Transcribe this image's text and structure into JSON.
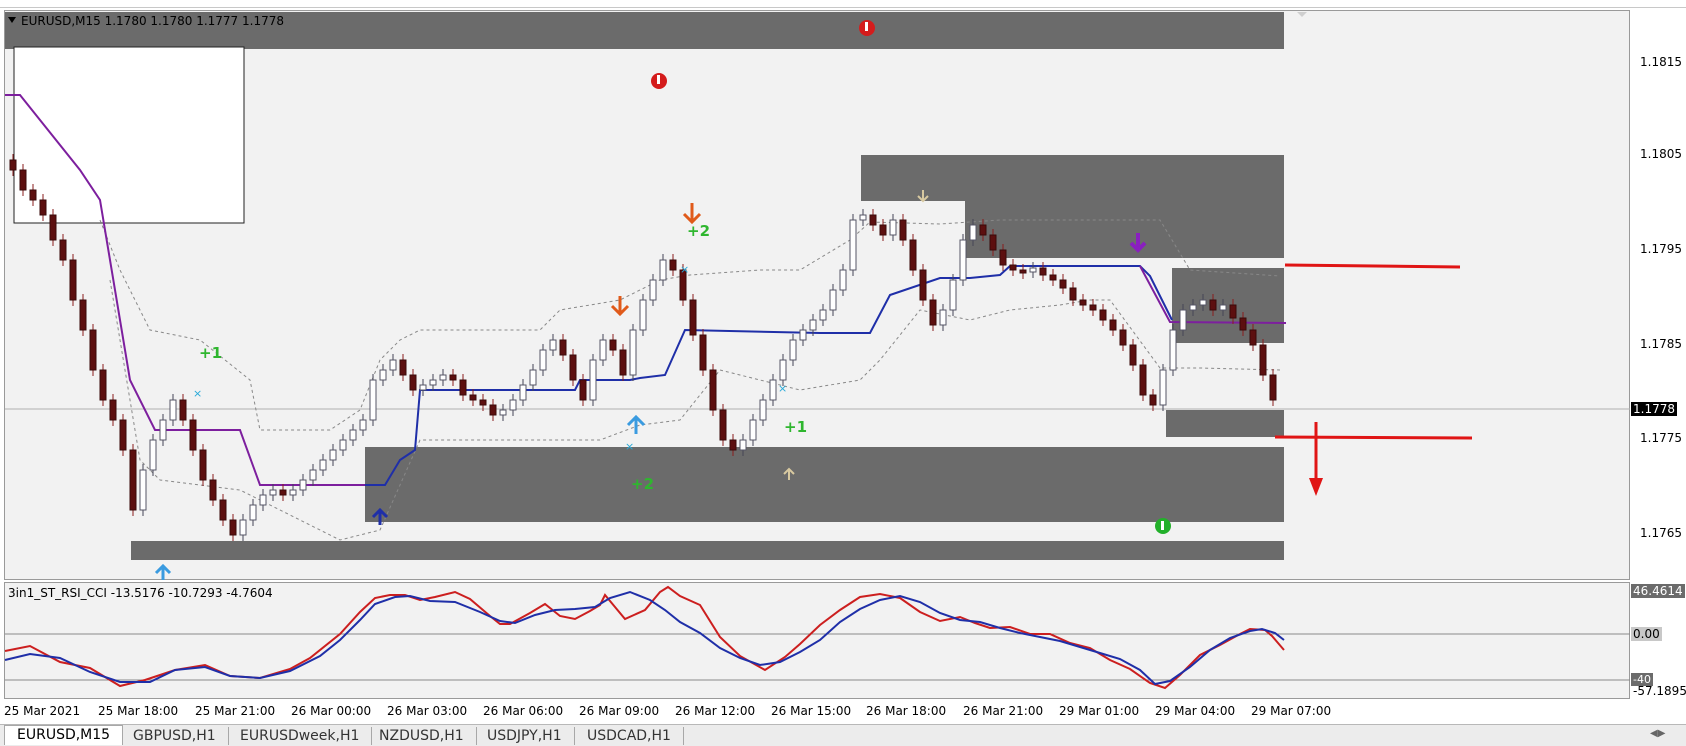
{
  "main_chart": {
    "title": "EURUSD,M15  1.1780 1.1780 1.1777 1.1778",
    "current_price_label": "1.1778",
    "price_ticks": [
      "1.1815",
      "1.1805",
      "1.1795",
      "1.1785",
      "1.1775",
      "1.1765"
    ],
    "signals": {
      "plus1_left": "+1",
      "plus2_upper": "+2",
      "plus2_lower": "+2",
      "plus1_right": "+1"
    }
  },
  "indicator": {
    "title": "3in1_ST_RSI_CCI -13.5176 -10.7293 -4.7604",
    "top_label": "46.4614",
    "zero_label": "0.00",
    "minus40_label": "-40",
    "bottom_label": "-57.1895"
  },
  "time_axis": [
    "25 Mar 2021",
    "25 Mar 18:00",
    "25 Mar 21:00",
    "26 Mar 00:00",
    "26 Mar 03:00",
    "26 Mar 06:00",
    "26 Mar 09:00",
    "26 Mar 12:00",
    "26 Mar 15:00",
    "26 Mar 18:00",
    "26 Mar 21:00",
    "29 Mar 01:00",
    "29 Mar 04:00",
    "29 Mar 07:00"
  ],
  "tabs": [
    {
      "label": "EURUSD,M15",
      "active": true
    },
    {
      "label": "GBPUSD,H1",
      "active": false
    },
    {
      "label": "EURUSDweek,H1",
      "active": false
    },
    {
      "label": "NZDUSD,H1",
      "active": false
    },
    {
      "label": "USDJPY,H1",
      "active": false
    },
    {
      "label": "USDCAD,H1",
      "active": false
    }
  ],
  "colors": {
    "zone": "#6b6b6b",
    "bull_body": "#ffffff",
    "bear_body": "#5c0f0f",
    "supertrend": "#1f2fa8",
    "ma_purple": "#7d1f9e",
    "rsi_red": "#cc1f1f",
    "cci_blue": "#1f2fa8",
    "annotation_red": "#e01515"
  }
}
